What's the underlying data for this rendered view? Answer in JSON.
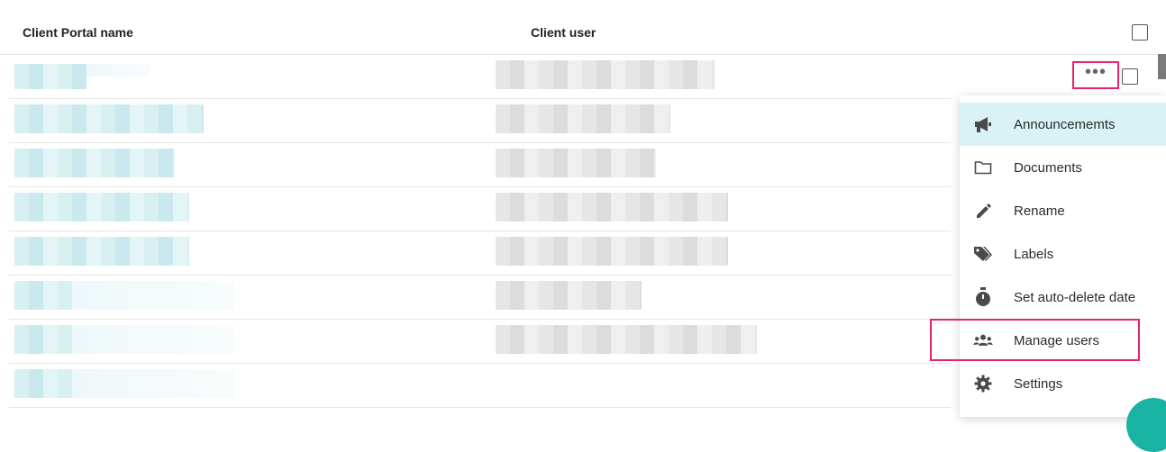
{
  "table": {
    "col_name": "Client Portal name",
    "col_user": "Client user"
  },
  "rows": [
    {
      "name": "",
      "user": ""
    },
    {
      "name": "",
      "user": ""
    },
    {
      "name": "",
      "user": ""
    },
    {
      "name": "",
      "user": ""
    },
    {
      "name": "",
      "user": ""
    },
    {
      "name": "",
      "user": ""
    },
    {
      "name": "",
      "user": ""
    },
    {
      "name": "",
      "user": ""
    }
  ],
  "more_button_label": "•••",
  "menu": {
    "items": [
      {
        "label": "Announcememts",
        "icon": "megaphone-icon",
        "active": true
      },
      {
        "label": "Documents",
        "icon": "folder-icon",
        "active": false
      },
      {
        "label": "Rename",
        "icon": "pencil-icon",
        "active": false
      },
      {
        "label": "Labels",
        "icon": "tags-icon",
        "active": false
      },
      {
        "label": "Set auto-delete date",
        "icon": "stopwatch-icon",
        "active": false
      },
      {
        "label": "Manage users",
        "icon": "users-icon",
        "active": false,
        "highlighted": true
      },
      {
        "label": "Settings",
        "icon": "gear-icon",
        "active": false
      }
    ]
  },
  "colors": {
    "accent_highlight": "#e8226e",
    "menu_active_bg": "#d9f2f5",
    "fab": "#19b3a4"
  }
}
